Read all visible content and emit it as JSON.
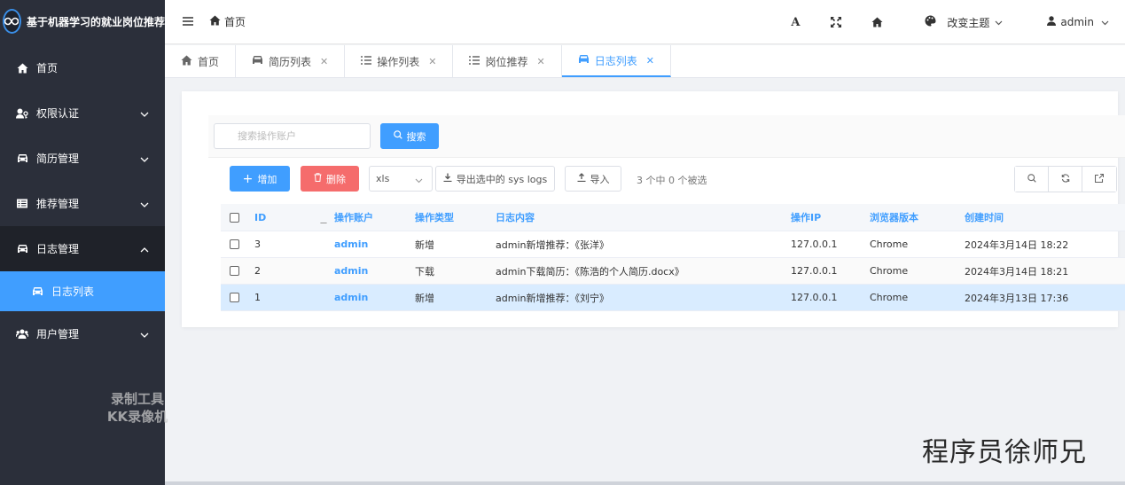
{
  "app": {
    "title": "基于机器学习的就业岗位推荐"
  },
  "sidebar": {
    "items": [
      {
        "label": "首页",
        "icon": "home-icon",
        "has_children": false
      },
      {
        "label": "权限认证",
        "icon": "user-key-icon",
        "has_children": true
      },
      {
        "label": "简历管理",
        "icon": "car-icon",
        "has_children": true
      },
      {
        "label": "推荐管理",
        "icon": "list-icon",
        "has_children": true
      },
      {
        "label": "日志管理",
        "icon": "car-icon",
        "has_children": true,
        "open": true
      },
      {
        "label": "用户管理",
        "icon": "users-icon",
        "has_children": true
      }
    ],
    "active_sub": {
      "label": "日志列表",
      "icon": "car-icon"
    }
  },
  "header": {
    "breadcrumb": "首页",
    "theme_label": "改变主题",
    "user_label": "admin",
    "font_icon_text": "A"
  },
  "tabs": [
    {
      "label": "首页",
      "icon": "home-icon",
      "closable": false,
      "active": false
    },
    {
      "label": "简历列表",
      "icon": "car-icon",
      "closable": true,
      "active": false
    },
    {
      "label": "操作列表",
      "icon": "list-icon",
      "closable": true,
      "active": false
    },
    {
      "label": "岗位推荐",
      "icon": "list-icon",
      "closable": true,
      "active": false
    },
    {
      "label": "日志列表",
      "icon": "car-icon",
      "closable": true,
      "active": true
    }
  ],
  "search": {
    "placeholder": "搜索操作账户",
    "button_label": "搜索"
  },
  "toolbar": {
    "add_label": "增加",
    "delete_label": "删除",
    "format_value": "xls",
    "export_label": "导出选中的 sys logs",
    "import_label": "导入",
    "selection_info": "3 个中 0 个被选"
  },
  "table": {
    "columns": [
      "ID",
      "操作账户",
      "操作类型",
      "日志内容",
      "操作IP",
      "浏览器版本",
      "创建时间"
    ],
    "rows": [
      {
        "id": "3",
        "account": "admin",
        "type": "新增",
        "content": "admin新增推荐：《张洋》",
        "ip": "127.0.0.1",
        "browser": "Chrome",
        "time": "2024年3月14日 18:22"
      },
      {
        "id": "2",
        "account": "admin",
        "type": "下载",
        "content": "admin下载简历：《陈浩的个人简历.docx》",
        "ip": "127.0.0.1",
        "browser": "Chrome",
        "time": "2024年3月14日 18:21"
      },
      {
        "id": "1",
        "account": "admin",
        "type": "新增",
        "content": "admin新增推荐：《刘宁》",
        "ip": "127.0.0.1",
        "browser": "Chrome",
        "time": "2024年3月13日 17:36"
      }
    ]
  },
  "overlays": {
    "recorder_line1": "录制工具",
    "recorder_line2": "KK录像机",
    "author": "程序员徐师兄"
  },
  "colors": {
    "primary": "#409eff",
    "danger": "#f56c6c",
    "sidebar_bg": "#2b2f3a"
  }
}
